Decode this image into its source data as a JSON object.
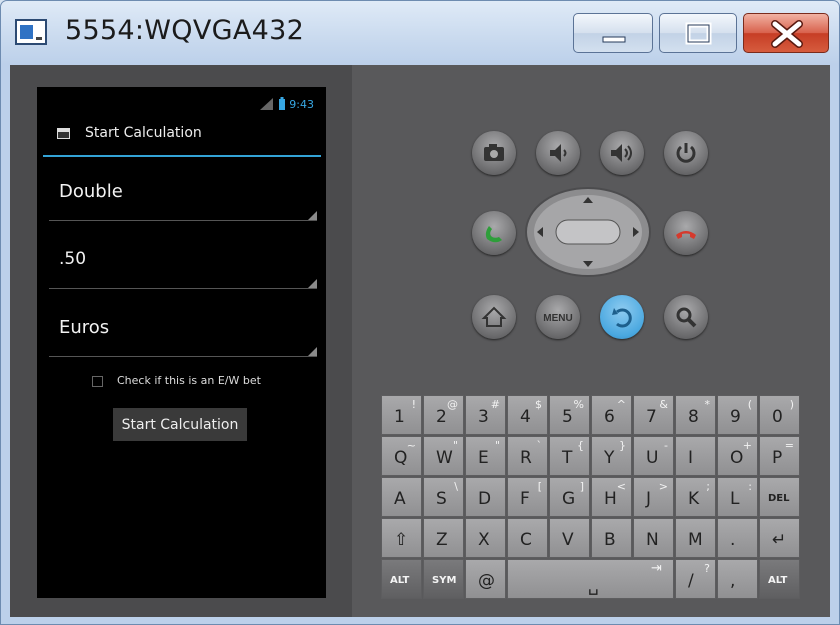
{
  "window": {
    "title": "5554:WQVGA432"
  },
  "colors": {
    "accent": "#33a3d6",
    "screen_bg": "#000000",
    "close": "#c8432a",
    "call": "#2e9e3a",
    "end_call": "#d53a2d",
    "back": "#4aa8e0"
  },
  "status_bar": {
    "time": "9:43"
  },
  "action_bar": {
    "title": "Start Calculation"
  },
  "form": {
    "bet_type": "Double",
    "odds": ".50",
    "currency": "Euros",
    "ew_label": "Check if this is an E/W bet",
    "start_button": "Start Calculation"
  },
  "controls": {
    "menu_label": "MENU"
  },
  "keyboard": {
    "row1": [
      {
        "main": "1",
        "sub": "!"
      },
      {
        "main": "2",
        "sub": "@"
      },
      {
        "main": "3",
        "sub": "#"
      },
      {
        "main": "4",
        "sub": "$"
      },
      {
        "main": "5",
        "sub": "%"
      },
      {
        "main": "6",
        "sub": "^"
      },
      {
        "main": "7",
        "sub": "&"
      },
      {
        "main": "8",
        "sub": "*"
      },
      {
        "main": "9",
        "sub": "("
      },
      {
        "main": "0",
        "sub": ")"
      }
    ],
    "row2": [
      {
        "main": "Q",
        "sub": "~"
      },
      {
        "main": "W",
        "sub": "\""
      },
      {
        "main": "E",
        "sub": "\""
      },
      {
        "main": "R",
        "sub": "`"
      },
      {
        "main": "T",
        "sub": "{"
      },
      {
        "main": "Y",
        "sub": "}"
      },
      {
        "main": "U",
        "sub": "-"
      },
      {
        "main": "I",
        "sub": ""
      },
      {
        "main": "O",
        "sub": "+"
      },
      {
        "main": "P",
        "sub": "="
      }
    ],
    "row3": [
      {
        "main": "A",
        "sub": ""
      },
      {
        "main": "S",
        "sub": "\\"
      },
      {
        "main": "D",
        "sub": ""
      },
      {
        "main": "F",
        "sub": "["
      },
      {
        "main": "G",
        "sub": "]"
      },
      {
        "main": "H",
        "sub": "<"
      },
      {
        "main": "J",
        "sub": ">"
      },
      {
        "main": "K",
        "sub": ";"
      },
      {
        "main": "L",
        "sub": ":"
      },
      {
        "main": "DEL",
        "sub": ""
      }
    ],
    "row4": [
      {
        "main": "⇧",
        "sub": ""
      },
      {
        "main": "Z",
        "sub": ""
      },
      {
        "main": "X",
        "sub": ""
      },
      {
        "main": "C",
        "sub": ""
      },
      {
        "main": "V",
        "sub": ""
      },
      {
        "main": "B",
        "sub": ""
      },
      {
        "main": "N",
        "sub": ""
      },
      {
        "main": "M",
        "sub": ""
      },
      {
        "main": ".",
        "sub": ""
      },
      {
        "main": "↵",
        "sub": ""
      }
    ],
    "row5": {
      "alt_left": "ALT",
      "sym": "SYM",
      "at": "@",
      "space": "␣",
      "tab": "⇥",
      "slash": "/",
      "question": "?",
      "comma": ",",
      "alt_right": "ALT"
    }
  }
}
